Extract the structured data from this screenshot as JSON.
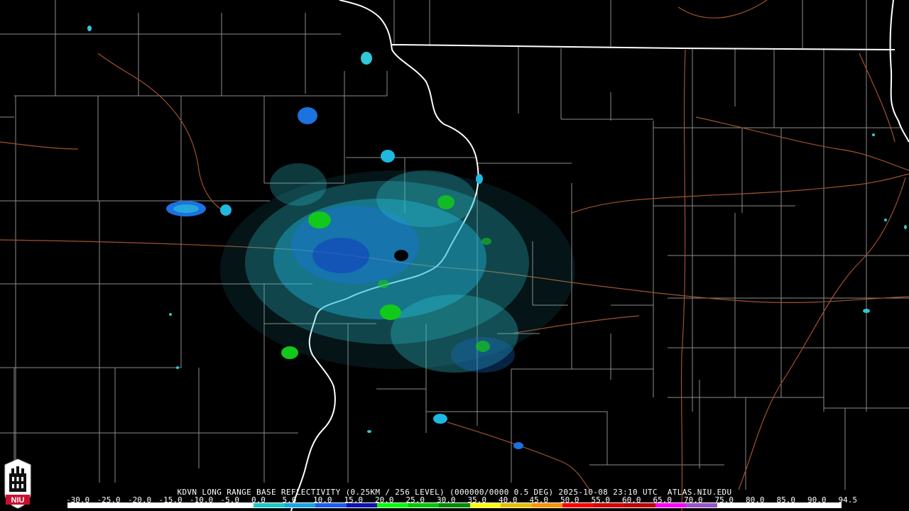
{
  "caption": {
    "station": "KDVN",
    "product": "LONG RANGE BASE REFLECTIVITY",
    "resolution": "(0.25KM / 256 LEVEL)",
    "code": "(000000/0000",
    "elevation": "0.5 DEG)",
    "date": "2025-10-08",
    "time": "23:10 UTC",
    "site": "ATLAS.NIU.EDU"
  },
  "logo": {
    "text": "NIU",
    "accent_color": "#c8102e"
  },
  "scale": {
    "labels": [
      "-30.0",
      "-25.0",
      "-20.0",
      "-15.0",
      "-10.0",
      "-5.0",
      "0.0",
      "5.0",
      "10.0",
      "15.0",
      "20.0",
      "25.0",
      "30.0",
      "35.0",
      "40.0",
      "45.0",
      "50.0",
      "55.0",
      "60.0",
      "65.0",
      "70.0",
      "75.0",
      "80.0",
      "85.0",
      "90.0",
      "94.5"
    ],
    "colors": [
      "#ffffff",
      "#ffffff",
      "#ffffff",
      "#ffffff",
      "#ffffff",
      "#ffffff",
      "#1fc8c8",
      "#17a6e6",
      "#1c5cf0",
      "#0a14b4",
      "#00ff00",
      "#00c800",
      "#008c00",
      "#ffff00",
      "#e6bf00",
      "#ff9000",
      "#ff0000",
      "#d60000",
      "#c00000",
      "#ff00ff",
      "#9955c9",
      "#ffffff",
      "#ffffff",
      "#ffffff",
      "#ffffff"
    ]
  },
  "map_colors": {
    "background": "#000000",
    "state_borders": "#ffffff",
    "county_lines": "#8c8c8c",
    "highways": "#a0522d",
    "echo_light": "#2fc9d8",
    "echo_medium": "#1b72e0",
    "echo_deep": "#1030c0",
    "echo_green": "#12c81a"
  }
}
